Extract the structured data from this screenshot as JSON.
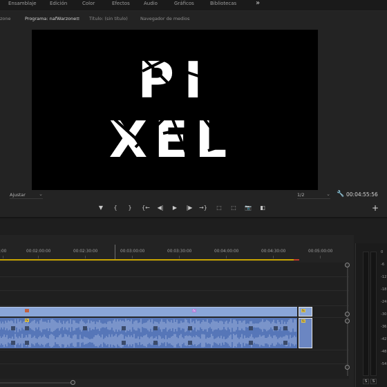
{
  "workspaces": [
    "Ensamblaje",
    "Edición",
    "Color",
    "Efectos",
    "Audio",
    "Gráficos",
    "Bibliotecas",
    "»"
  ],
  "tabs": {
    "left_partial": "zone",
    "program": "Programa: nafWarzone",
    "program_menu": "≡",
    "title": "Título: (sin título)",
    "media_browser": "Navegador de medios"
  },
  "viewer": {
    "fit": "Ajustar",
    "fit_arrow": "⌄",
    "resolution": "1/2",
    "resolution_arrow": "⌄",
    "settings_icon": "wrench-icon",
    "timecode": "00:04:55:56",
    "frame_text_line1": "PI",
    "frame_text_line2": "XEL"
  },
  "transport": {
    "add_marker": "▼",
    "mark_in": "{",
    "mark_out": "}",
    "go_to_in": "{←",
    "step_back": "◀|",
    "play": "▶",
    "step_forward": "|▶",
    "go_to_out": "→}",
    "lift": "⬚",
    "extract": "⬚",
    "export_frame": "📷",
    "comparison": "◧",
    "add_button": "+"
  },
  "timeline": {
    "ruler_labels": [
      ":00",
      "00:02:00:00",
      "00:02:30:00",
      "00:03:00:00",
      "00:03:30:00",
      "00:04:00:00",
      "00:04:30:00",
      "00:05:00:00"
    ]
  },
  "meter": {
    "db_labels": [
      "0",
      "-6",
      "-12",
      "-18",
      "-24",
      "-30",
      "-36",
      "-42",
      "-48",
      "-54"
    ],
    "solo_left": "S",
    "solo_right": "S"
  },
  "colors": {
    "video_clip": "#8aa6d8",
    "audio_clip": "#5676b8",
    "work_area": "#c9a400",
    "accent": "#ffffff"
  }
}
